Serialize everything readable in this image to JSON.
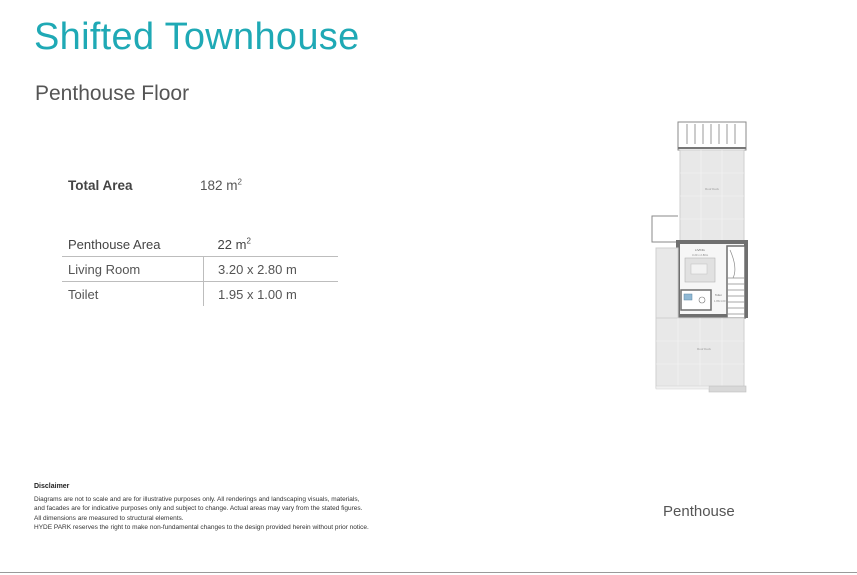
{
  "header": {
    "title": "Shifted Townhouse",
    "subtitle": "Penthouse Floor"
  },
  "total_area": {
    "label": "Total Area",
    "value": "182 m",
    "unit_sup": "2"
  },
  "area_table": {
    "header": {
      "name": "Penthouse Area",
      "value": "22 m",
      "unit_sup": "2"
    },
    "rows": [
      {
        "name": "Living Room",
        "value": "3.20 x 2.80 m"
      },
      {
        "name": "Toilet",
        "value": "1.95 x 1.00 m"
      }
    ]
  },
  "disclaimer": {
    "title": "Disclaimer",
    "lines": [
      "Diagrams are not to scale and are for illustrative purposes only. All renderings and landscaping visuals, materials,",
      "and facades are for indicative purposes only and subject to change. Actual areas may vary from the stated figures.",
      "All dimensions are measured to structural elements.",
      "HYDE PARK reserves the right to make non-fundamental changes to the design provided herein without prior notice."
    ]
  },
  "floor_plan": {
    "caption": "Penthouse",
    "colors": {
      "wall": "#6f6f6f",
      "terrace": "#e8e8e8",
      "room": "#f6f6f6"
    }
  }
}
